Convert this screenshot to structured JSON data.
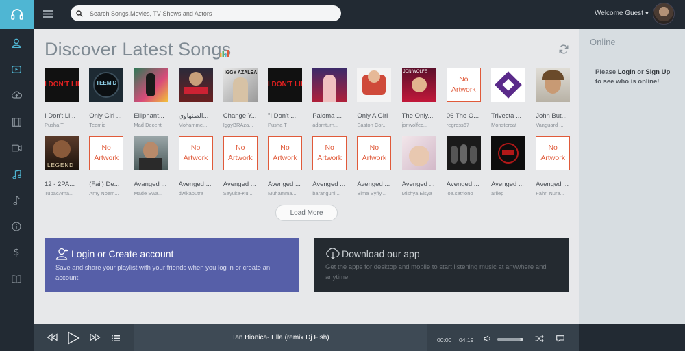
{
  "header": {
    "search_placeholder": "Search Songs,Movies, TV Shows and Actors",
    "welcome": "Welcome Guest"
  },
  "sidebar": {
    "items": [
      {
        "icon": "user-icon"
      },
      {
        "icon": "youtube-icon"
      },
      {
        "icon": "cloud-upload-icon"
      },
      {
        "icon": "film-icon"
      },
      {
        "icon": "video-camera-icon"
      },
      {
        "icon": "music-notes-icon",
        "active": true
      },
      {
        "icon": "music-note-icon"
      },
      {
        "icon": "info-icon"
      },
      {
        "icon": "dollar-icon"
      },
      {
        "icon": "book-icon"
      }
    ]
  },
  "main": {
    "title": "Discover Latest Songs",
    "load_more": "Load More",
    "no_artwork_line1": "No",
    "no_artwork_line2": "Artwork",
    "songs_row1": [
      {
        "title": "I Don't Li...",
        "artist": "Pusha T",
        "art": "text-dont-like"
      },
      {
        "title": "Only Girl ...",
        "artist": "Teemid",
        "art": "teemid"
      },
      {
        "title": "Elliphant...",
        "artist": "Mad Decent",
        "art": "elliphant"
      },
      {
        "title": "الصنهاوي...",
        "artist": "Mohamme...",
        "art": "arabic"
      },
      {
        "title": "Change Y...",
        "artist": "IggyBRAza...",
        "art": "iggy"
      },
      {
        "title": "\"I Don't ...",
        "artist": "Pusha T",
        "art": "text-dont-like"
      },
      {
        "title": "Paloma ...",
        "artist": "adamturn...",
        "art": "paloma"
      },
      {
        "title": "Only A Girl",
        "artist": "Easton Cor...",
        "art": "onlygirl"
      },
      {
        "title": "The Only...",
        "artist": "jonwolfec...",
        "art": "jonwolf"
      },
      {
        "title": "06 The O...",
        "artist": "regross67",
        "art": "none"
      },
      {
        "title": "Trivecta ...",
        "artist": "Monstercat",
        "art": "monstercat"
      },
      {
        "title": "John But...",
        "artist": "Vanguard ...",
        "art": "johnbutler"
      }
    ],
    "songs_row2": [
      {
        "title": "12 - 2PA...",
        "artist": "TupacAma...",
        "art": "legend"
      },
      {
        "title": "(Fail) De...",
        "artist": "Amy Noem...",
        "art": "none"
      },
      {
        "title": "Avanged ...",
        "artist": "Made Swa...",
        "art": "man"
      },
      {
        "title": "Avenged ...",
        "artist": "dwikaputra",
        "art": "none"
      },
      {
        "title": "Avenged ...",
        "artist": "Sayuka-Ku...",
        "art": "none"
      },
      {
        "title": "Avenged ...",
        "artist": "Muhamma...",
        "art": "none"
      },
      {
        "title": "Avenged ...",
        "artist": "baranguni...",
        "art": "none"
      },
      {
        "title": "Avenged ...",
        "artist": "Bima Syñy...",
        "art": "none"
      },
      {
        "title": "Avenged ...",
        "artist": "Mishya Eisya",
        "art": "girl"
      },
      {
        "title": "Avenged ...",
        "artist": "joe.satriono",
        "art": "band"
      },
      {
        "title": "Avenged ...",
        "artist": "ariiep",
        "art": "a7x"
      },
      {
        "title": "Avenged ...",
        "artist": "Fahri Nura...",
        "art": "none"
      }
    ],
    "login_card": {
      "title": "Login or Create account",
      "text": "Save and share your playlist with your friends when you log in or create an account."
    },
    "app_card": {
      "title": "Download our app",
      "text": "Get the apps for desktop and mobile to start listening music at anywhere and anytime."
    }
  },
  "right_panel": {
    "title": "Online",
    "hint_prefix": "Please ",
    "hint_login": "Login",
    "hint_or": " or ",
    "hint_signup": "Sign Up",
    "hint_suffix": " to see who is online!"
  },
  "player": {
    "now_playing": "Tan Bionica- Ella (remix Dj Fish)",
    "current_time": "00:00",
    "duration": "04:19",
    "volume": 0.9
  },
  "colors": {
    "accent": "#4fb6d3",
    "dark": "#222a33",
    "no_artwork": "#e05a3a",
    "login_card": "#565fa8",
    "app_card": "#242a30"
  }
}
